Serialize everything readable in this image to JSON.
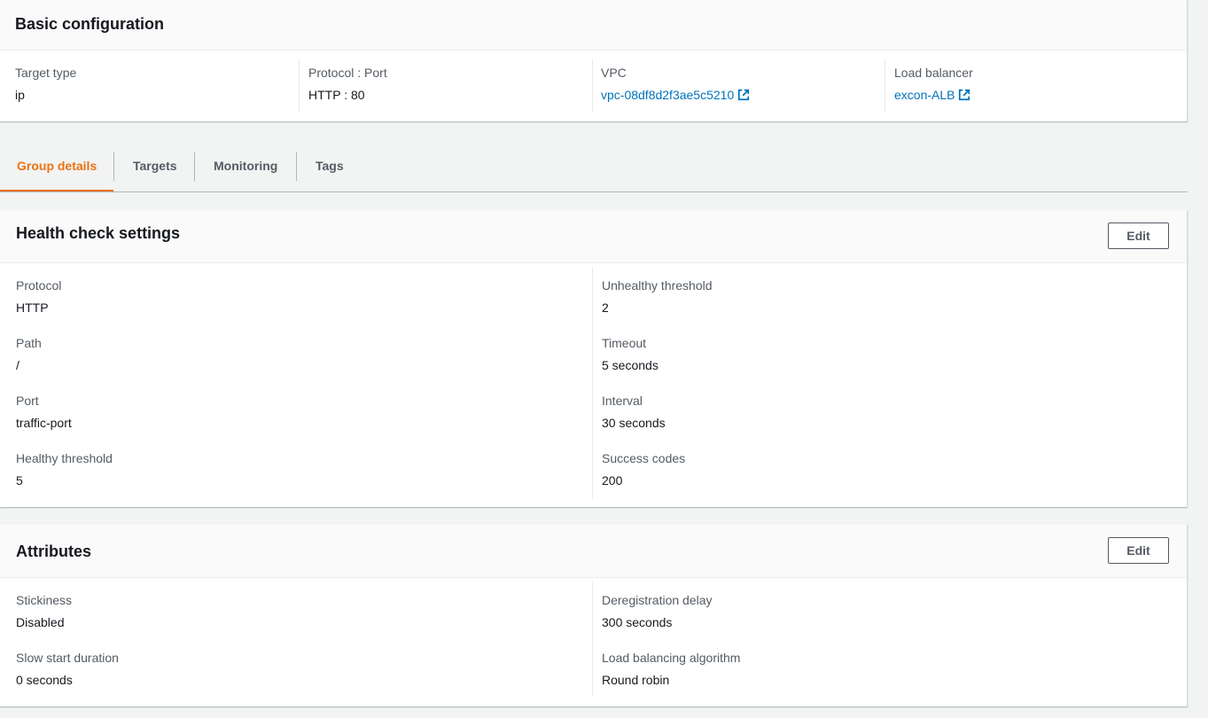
{
  "basic_config": {
    "title": "Basic configuration",
    "target_type": {
      "label": "Target type",
      "value": "ip"
    },
    "protocol_port": {
      "label": "Protocol : Port",
      "value": "HTTP : 80"
    },
    "vpc": {
      "label": "VPC",
      "value": "vpc-08df8d2f3ae5c5210"
    },
    "load_balancer": {
      "label": "Load balancer",
      "value": "excon-ALB"
    }
  },
  "tabs": [
    {
      "label": "Group details",
      "active": true
    },
    {
      "label": "Targets",
      "active": false
    },
    {
      "label": "Monitoring",
      "active": false
    },
    {
      "label": "Tags",
      "active": false
    }
  ],
  "health_check": {
    "title": "Health check settings",
    "edit_label": "Edit",
    "left": [
      {
        "label": "Protocol",
        "value": "HTTP"
      },
      {
        "label": "Path",
        "value": "/"
      },
      {
        "label": "Port",
        "value": "traffic-port"
      },
      {
        "label": "Healthy threshold",
        "value": "5"
      }
    ],
    "right": [
      {
        "label": "Unhealthy threshold",
        "value": "2"
      },
      {
        "label": "Timeout",
        "value": "5 seconds"
      },
      {
        "label": "Interval",
        "value": "30 seconds"
      },
      {
        "label": "Success codes",
        "value": "200"
      }
    ]
  },
  "attributes": {
    "title": "Attributes",
    "edit_label": "Edit",
    "left": [
      {
        "label": "Stickiness",
        "value": "Disabled"
      },
      {
        "label": "Slow start duration",
        "value": "0 seconds"
      }
    ],
    "right": [
      {
        "label": "Deregistration delay",
        "value": "300 seconds"
      },
      {
        "label": "Load balancing algorithm",
        "value": "Round robin"
      }
    ]
  },
  "colors": {
    "accent_tab": "#ec7211",
    "link": "#0073bb",
    "label": "#545b64",
    "background": "#f2f3f3"
  },
  "icons": {
    "external_link": "external-link-icon"
  }
}
